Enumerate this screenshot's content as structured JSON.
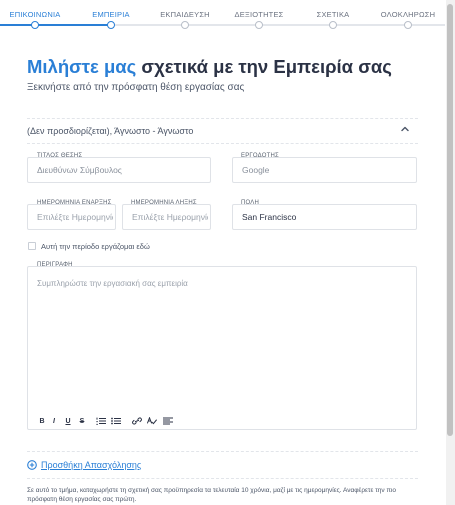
{
  "steps": {
    "items": [
      {
        "label": "ΕΠΙΚΟΙΝΩΝΙΑ",
        "state": "done"
      },
      {
        "label": "ΕΜΠΕΙΡΙΑ",
        "state": "active"
      },
      {
        "label": "ΕΚΠΑΙΔΕΥΣΗ",
        "state": "pending"
      },
      {
        "label": "ΔΕΞΙΟΤΗΤΕΣ",
        "state": "pending"
      },
      {
        "label": "ΣΧΕΤΙΚΑ",
        "state": "pending"
      },
      {
        "label": "ΟΛΟΚΛΗΡΩΣΗ",
        "state": "pending"
      }
    ]
  },
  "heading": {
    "accent": "Μιλήστε μας",
    "rest": " σχετικά με την Εμπειρία σας",
    "subtitle": "Ξεκινήστε από την πρόσφατη θέση εργασίας σας"
  },
  "entry": {
    "summary": "(Δεν προσδιορίζεται), Άγνωστο - Άγνωστο",
    "job_title": {
      "label": "ΤΙΤΛΟΣ ΘΕΣΗΣ",
      "value": "Διευθύνων Σύμβουλος"
    },
    "employer": {
      "label": "ΕΡΓΟΔΟΤΗΣ",
      "value": "Google"
    },
    "start_date": {
      "label": "ΗΜΕΡΟΜΗΝΙΑ ΕΝΑΡΞΗΣ",
      "placeholder": "Επιλέξτε Ημερομηνία"
    },
    "end_date": {
      "label": "ΗΜΕΡΟΜΗΝΙΑ ΛΗΞΗΣ",
      "placeholder": "Επιλέξτε Ημερομηνία"
    },
    "city": {
      "label": "ΠΟΛΗ",
      "value": "San Francisco"
    },
    "current_label": "Αυτή την περίοδο εργάζομαι εδώ",
    "description": {
      "label": "ΠΕΡΙΓΡΑΦΗ",
      "placeholder": "Συμπληρώστε την εργασιακή σας εμπειρία"
    }
  },
  "toolbar": {
    "bold": "B",
    "italic": "I",
    "underline": "U",
    "strike": "S"
  },
  "add_employment": "Προσθήκη Απασχόλησης",
  "note": "Σε αυτό το τμήμα, καταχωρήστε τη σχετική σας προϋπηρεσία τα τελευταία 10 χρόνια, μαζί με τις ημερομηνίες. Αναφέρετε την πιο πρόσφατη θέση εργασίας σας πρώτη.",
  "colors": {
    "accent": "#2a7fd6",
    "text": "#2b3245"
  }
}
